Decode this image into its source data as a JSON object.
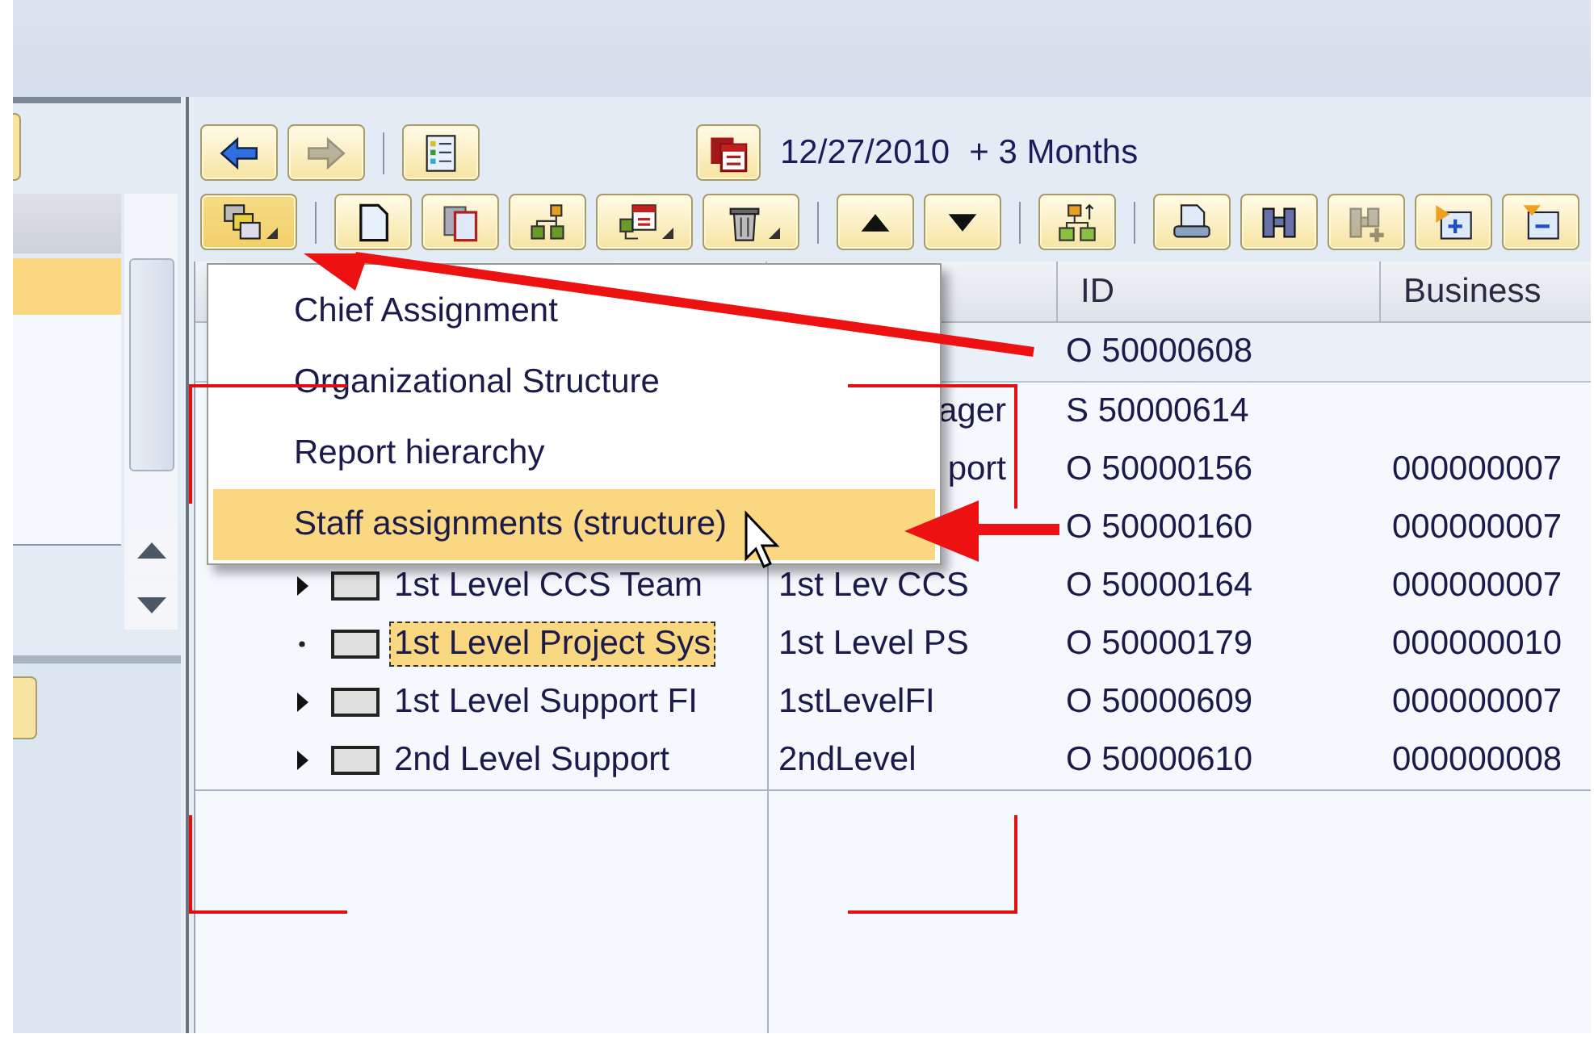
{
  "left_pane": {
    "rows": [
      {
        "selected": true
      }
    ]
  },
  "toolbar_rows": [
    {
      "buttons": [
        {
          "kind": "button",
          "disabled": false,
          "dropdown": false,
          "pressed": false
        },
        {
          "kind": "button",
          "disabled": true,
          "dropdown": false,
          "pressed": false
        },
        {
          "kind": "separator"
        },
        {
          "kind": "button",
          "disabled": false,
          "dropdown": false,
          "pressed": false
        }
      ]
    },
    {
      "buttons": [
        {
          "kind": "button",
          "disabled": false,
          "dropdown": true,
          "pressed": true
        },
        {
          "kind": "separator"
        },
        {
          "kind": "button",
          "disabled": false,
          "dropdown": false,
          "pressed": false
        },
        {
          "kind": "button",
          "disabled": false,
          "dropdown": false,
          "pressed": false
        },
        {
          "kind": "button",
          "disabled": false,
          "dropdown": false,
          "pressed": false
        },
        {
          "kind": "button",
          "disabled": false,
          "dropdown": true,
          "pressed": false
        },
        {
          "kind": "button",
          "disabled": false,
          "dropdown": true,
          "pressed": false
        },
        {
          "kind": "separator"
        },
        {
          "kind": "button",
          "disabled": false,
          "dropdown": false,
          "pressed": false
        },
        {
          "kind": "button",
          "disabled": false,
          "dropdown": false,
          "pressed": false
        },
        {
          "kind": "separator"
        },
        {
          "kind": "button",
          "disabled": false,
          "dropdown": false,
          "pressed": false
        },
        {
          "kind": "separator"
        },
        {
          "kind": "button",
          "disabled": false,
          "dropdown": false,
          "pressed": false
        },
        {
          "kind": "button",
          "disabled": false,
          "dropdown": false,
          "pressed": false
        },
        {
          "kind": "button",
          "disabled": true,
          "dropdown": false,
          "pressed": false
        },
        {
          "kind": "button",
          "disabled": false,
          "dropdown": false,
          "pressed": false
        },
        {
          "kind": "button",
          "disabled": false,
          "dropdown": false,
          "pressed": false
        }
      ]
    }
  ],
  "date_nav": {
    "date": "12/27/2010",
    "range": "+ 3 Months"
  },
  "table": {
    "columns": [
      "ID",
      "Business"
    ],
    "rows": [
      {
        "kind": "root",
        "id": "O 50000608"
      },
      {
        "kind": "node",
        "column_2": "ager",
        "id": "S 50000614"
      },
      {
        "kind": "node",
        "column_2": "port",
        "id": "O 50000156",
        "business": "000000007"
      },
      {
        "kind": "node",
        "id": "O 50000160",
        "business": "000000007"
      },
      {
        "kind": "node",
        "selected": false,
        "expandable": true,
        "column_1": "1st Level CCS Team",
        "column_2": "1st Lev CCS",
        "id": "O 50000164",
        "business": "000000007"
      },
      {
        "kind": "node",
        "selected": true,
        "expandable": false,
        "column_1": "1st Level Project Sys",
        "column_2": "1st Level PS",
        "id": "O 50000179",
        "business": "000000010"
      },
      {
        "kind": "node",
        "selected": false,
        "expandable": true,
        "column_1": "1st  Level Support FI",
        "column_2": "1stLevelFI",
        "id": "O 50000609",
        "business": "000000007"
      },
      {
        "kind": "node",
        "selected": false,
        "expandable": true,
        "column_1": "2nd Level Support",
        "column_2": "2ndLevel",
        "id": "O 50000610",
        "business": "000000008"
      }
    ]
  },
  "context_menu": {
    "items": [
      {
        "label": "Chief Assignment",
        "selected": false
      },
      {
        "label": "Organizational Structure",
        "selected": false
      },
      {
        "label": "Report hierarchy",
        "selected": false
      },
      {
        "label": "Staff assignments (structure)",
        "selected": true
      }
    ]
  }
}
